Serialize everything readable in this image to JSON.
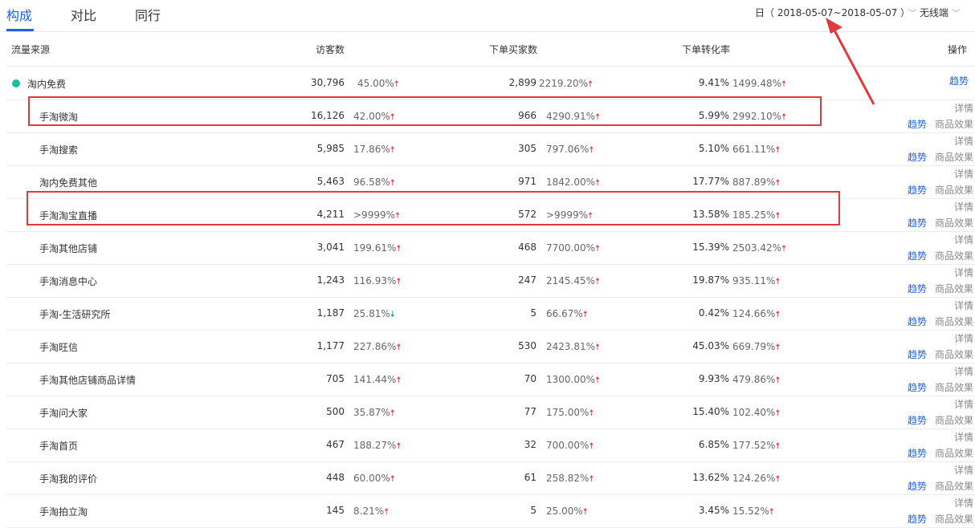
{
  "tabs": [
    {
      "label": "构成",
      "active": true
    },
    {
      "label": "对比",
      "active": false
    },
    {
      "label": "同行",
      "active": false
    }
  ],
  "filters": {
    "date_range": "日（ 2018-05-07~2018-05-07 ）",
    "device": "无线端"
  },
  "table": {
    "headers": {
      "source": "流量来源",
      "visitors": "访客数",
      "buyers": "下单买家数",
      "conversion": "下单转化率",
      "action": "操作"
    },
    "group": {
      "name": "淘内免费",
      "visitors": "30,796",
      "visitors_change": "45.00%",
      "visitors_dir": "up",
      "buyers": "2,899",
      "buyers_change": "2219.20%",
      "buyers_dir": "up",
      "conversion": "9.41%",
      "conversion_change": "1499.48%",
      "conversion_dir": "up",
      "action_trend": "趋势"
    },
    "rows": [
      {
        "name": "手淘微淘",
        "visitors": "16,126",
        "visitors_change": "42.00%",
        "visitors_dir": "up",
        "buyers": "966",
        "buyers_change": "4290.91%",
        "buyers_dir": "up",
        "conversion": "5.99%",
        "conversion_change": "2992.10%",
        "conversion_dir": "up",
        "detail": "详情",
        "trend": "趋势",
        "product": "商品效果",
        "highlighted": true
      },
      {
        "name": "手淘搜索",
        "visitors": "5,985",
        "visitors_change": "17.86%",
        "visitors_dir": "up",
        "buyers": "305",
        "buyers_change": "797.06%",
        "buyers_dir": "up",
        "conversion": "5.10%",
        "conversion_change": "661.11%",
        "conversion_dir": "up",
        "detail": "详情",
        "trend": "趋势",
        "product": "商品效果"
      },
      {
        "name": "淘内免费其他",
        "visitors": "5,463",
        "visitors_change": "96.58%",
        "visitors_dir": "up",
        "buyers": "971",
        "buyers_change": "1842.00%",
        "buyers_dir": "up",
        "conversion": "17.77%",
        "conversion_change": "887.89%",
        "conversion_dir": "up",
        "detail": "详情",
        "trend": "趋势",
        "product": "商品效果"
      },
      {
        "name": "手淘淘宝直播",
        "visitors": "4,211",
        "visitors_change": ">9999%",
        "visitors_dir": "up",
        "buyers": "572",
        "buyers_change": ">9999%",
        "buyers_dir": "up",
        "conversion": "13.58%",
        "conversion_change": "185.25%",
        "conversion_dir": "up",
        "detail": "详情",
        "trend": "趋势",
        "product": "商品效果",
        "highlighted": true
      },
      {
        "name": "手淘其他店铺",
        "visitors": "3,041",
        "visitors_change": "199.61%",
        "visitors_dir": "up",
        "buyers": "468",
        "buyers_change": "7700.00%",
        "buyers_dir": "up",
        "conversion": "15.39%",
        "conversion_change": "2503.42%",
        "conversion_dir": "up",
        "detail": "详情",
        "trend": "趋势",
        "product": "商品效果"
      },
      {
        "name": "手淘消息中心",
        "visitors": "1,243",
        "visitors_change": "116.93%",
        "visitors_dir": "up",
        "buyers": "247",
        "buyers_change": "2145.45%",
        "buyers_dir": "up",
        "conversion": "19.87%",
        "conversion_change": "935.11%",
        "conversion_dir": "up",
        "detail": "详情",
        "trend": "趋势",
        "product": "商品效果"
      },
      {
        "name": "手淘-生活研究所",
        "visitors": "1,187",
        "visitors_change": "25.81%",
        "visitors_dir": "down",
        "buyers": "5",
        "buyers_change": "66.67%",
        "buyers_dir": "up",
        "conversion": "0.42%",
        "conversion_change": "124.66%",
        "conversion_dir": "up",
        "detail": "详情",
        "trend": "趋势",
        "product": "商品效果"
      },
      {
        "name": "手淘旺信",
        "visitors": "1,177",
        "visitors_change": "227.86%",
        "visitors_dir": "up",
        "buyers": "530",
        "buyers_change": "2423.81%",
        "buyers_dir": "up",
        "conversion": "45.03%",
        "conversion_change": "669.79%",
        "conversion_dir": "up",
        "detail": "详情",
        "trend": "趋势",
        "product": "商品效果"
      },
      {
        "name": "手淘其他店铺商品详情",
        "visitors": "705",
        "visitors_change": "141.44%",
        "visitors_dir": "up",
        "buyers": "70",
        "buyers_change": "1300.00%",
        "buyers_dir": "up",
        "conversion": "9.93%",
        "conversion_change": "479.86%",
        "conversion_dir": "up",
        "detail": "详情",
        "trend": "趋势",
        "product": "商品效果"
      },
      {
        "name": "手淘问大家",
        "visitors": "500",
        "visitors_change": "35.87%",
        "visitors_dir": "up",
        "buyers": "77",
        "buyers_change": "175.00%",
        "buyers_dir": "up",
        "conversion": "15.40%",
        "conversion_change": "102.40%",
        "conversion_dir": "up",
        "detail": "详情",
        "trend": "趋势",
        "product": "商品效果"
      },
      {
        "name": "手淘首页",
        "visitors": "467",
        "visitors_change": "188.27%",
        "visitors_dir": "up",
        "buyers": "32",
        "buyers_change": "700.00%",
        "buyers_dir": "up",
        "conversion": "6.85%",
        "conversion_change": "177.52%",
        "conversion_dir": "up",
        "detail": "详情",
        "trend": "趋势",
        "product": "商品效果"
      },
      {
        "name": "手淘我的评价",
        "visitors": "448",
        "visitors_change": "60.00%",
        "visitors_dir": "up",
        "buyers": "61",
        "buyers_change": "258.82%",
        "buyers_dir": "up",
        "conversion": "13.62%",
        "conversion_change": "124.26%",
        "conversion_dir": "up",
        "detail": "详情",
        "trend": "趋势",
        "product": "商品效果"
      },
      {
        "name": "手淘拍立淘",
        "visitors": "145",
        "visitors_change": "8.21%",
        "visitors_dir": "up",
        "buyers": "5",
        "buyers_change": "25.00%",
        "buyers_dir": "up",
        "conversion": "3.45%",
        "conversion_change": "15.52%",
        "conversion_dir": "up",
        "detail": "详情",
        "trend": "趋势",
        "product": "商品效果"
      }
    ]
  },
  "colors": {
    "accent": "#2062e6",
    "up": "#e64552",
    "down": "#16b36f",
    "highlight": "#e03a3e",
    "group_dot": "#1bbf9b"
  },
  "icons": {
    "up": "arrow-up-icon",
    "down": "arrow-down-icon",
    "chevron": "chevron-down-icon"
  }
}
